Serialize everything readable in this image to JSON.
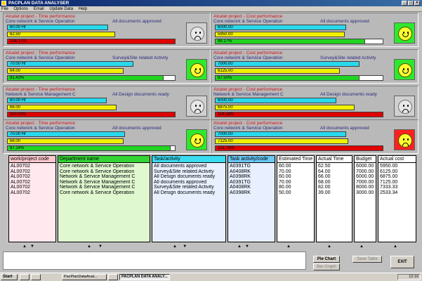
{
  "window": {
    "title": "PACPLAN DATA ANALYSER"
  },
  "menu": [
    "File",
    "Options",
    "Email",
    "Update Data",
    "Help"
  ],
  "panels": [
    {
      "title": "Alcatel project - Time performance",
      "subtitle": "Core network & Service Operation",
      "note": "All documents approved",
      "bar1": "60.00 Hr",
      "bar2": "62.50",
      "bar3": "104.17%",
      "bar3_color": "red",
      "face": "sad",
      "w1": 0.6,
      "w2": 0.64,
      "w3": 1.0
    },
    {
      "title": "Alcatel project - Cost performance",
      "subtitle": "Core network & Service Operation",
      "note": "All documents approved",
      "bar1": "6000.00",
      "bar2": "5950.00",
      "bar3": "99.17%",
      "bar3_color": "green",
      "face": "happy",
      "w1": 0.78,
      "w2": 0.77,
      "w3": 0.89
    },
    {
      "title": "Alcatel project - Time performance",
      "subtitle": "Core network & Service Operation",
      "note": "Survey&Site related Activity",
      "bar1": "70.00 Hr",
      "bar2": "64.00",
      "bar3": "91.43%",
      "bar3_color": "green",
      "face": "happy",
      "w1": 0.75,
      "w2": 0.69,
      "w3": 0.93
    },
    {
      "title": "Alcatel project - Cost performance",
      "subtitle": "Core network & Service Operation",
      "note": "Survey&Site related Activity",
      "bar1": "7000.00",
      "bar2": "6125.00",
      "bar3": "87.50%",
      "bar3_color": "green",
      "face": "happy",
      "w1": 0.86,
      "w2": 0.74,
      "w3": 0.86
    },
    {
      "title": "Alcatel project - Time performance",
      "subtitle": "Network & Service Management C",
      "note": "All Design documents ready",
      "bar1": "60.00 Hr",
      "bar2": "66.00",
      "bar3": "110.00%",
      "bar3_color": "red",
      "face": "sad",
      "w1": 0.59,
      "w2": 0.65,
      "w3": 1.0
    },
    {
      "title": "Alcatel project - Cost performance",
      "subtitle": "Network & Service Management C",
      "note": "All Design documents ready",
      "bar1": "6000.00",
      "bar2": "6875.00",
      "bar3": "114.58%",
      "bar3_color": "red",
      "face": "sad",
      "w1": 0.72,
      "w2": 0.83,
      "w3": 1.0
    },
    {
      "title": "Alcatel project - Time performance",
      "subtitle": "Core network & Service Operation",
      "note": "All documents approved",
      "bar1": "70.00 Hr",
      "bar2": "68.00",
      "bar3": "97.14%",
      "bar3_color": "green",
      "face": "happy",
      "w1": 0.7,
      "w2": 0.69,
      "w3": 0.97
    },
    {
      "title": "Alcatel project - Cost performance",
      "subtitle": "Core network & Service Operation",
      "note": "All documents approved",
      "bar1": "7000.00",
      "bar2": "7125.00",
      "bar3": "101.79%",
      "bar3_color": "red",
      "face": "sad-bright",
      "w1": 0.78,
      "w2": 0.79,
      "w3": 1.0
    }
  ],
  "table": {
    "headers": {
      "code": "work/project code",
      "dept": "Department name",
      "task": "Task/activity",
      "taskcode": "Task activity/code",
      "est": "Estimated Time",
      "actual": "Actual Time",
      "budget": "Budget",
      "cost": "Actual cost"
    },
    "code": [
      "AL00702",
      "AL00702",
      "AL00702",
      "AL00702",
      "AL00702",
      "AL00702"
    ],
    "dept": [
      "Core network & Service Operation",
      "Core network & Service Operation",
      "Network & Service Management C",
      "Network & Service Management C",
      "Network & Service Management C",
      "Core network & Service Operation"
    ],
    "task": [
      "All documents approved",
      "Survey&Site related Activity",
      "All Design documents ready",
      "All documents approved",
      "Survey&Site related Activity",
      "All Design documents ready"
    ],
    "taskcode": [
      "A0391TG",
      "A0408RK",
      "A0398RK",
      "A0391TG",
      "A0408RK",
      "A0398RK"
    ],
    "est": [
      "60.00",
      "70.00",
      "60.00",
      "70.00",
      "80.00",
      "50.00"
    ],
    "actual": [
      "62.50",
      "64.00",
      "66.00",
      "68.00",
      "82.00",
      "39.00"
    ],
    "budget": [
      "6000.00",
      "7000.00",
      "6000.00",
      "7000.00",
      "8000.00",
      "3000.00"
    ],
    "cost": [
      "5950.00",
      "6125.00",
      "6875.00",
      "7125.00",
      "7333.33",
      "2533.34"
    ]
  },
  "buttons": {
    "pie_chart": "Pie Chart",
    "bar_graph": "Bar Graph",
    "save_table": "Save Table",
    "exit": "EXIT"
  },
  "taskbar": {
    "start": "Start",
    "tasks": [
      "",
      "",
      "PacPlanDataAnal...",
      "",
      "PACPLAN DATA ANALY..."
    ],
    "clock": "12:16"
  }
}
